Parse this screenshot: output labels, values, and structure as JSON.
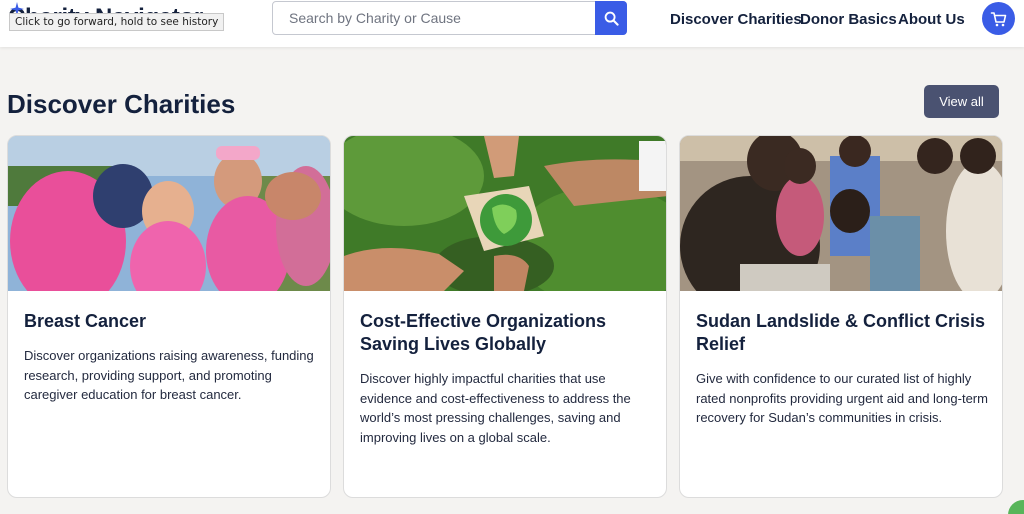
{
  "header": {
    "logo_text": "Charity Navigator",
    "tooltip": "Click to go forward, hold to see history",
    "search_placeholder": "Search by Charity or Cause",
    "nav": [
      "Discover Charities",
      "Donor Basics",
      "About Us"
    ],
    "icons": {
      "search": "search-icon",
      "cart": "cart-icon",
      "logo": "sparkle-icon"
    },
    "accent_color": "#3a5ce6"
  },
  "section": {
    "title": "Discover Charities",
    "view_all_label": "View all"
  },
  "cards": [
    {
      "title": "Breast Cancer",
      "description": "Discover organizations raising awareness, funding research, providing support, and promoting caregiver education for breast cancer.",
      "image": "pink-ribbon-walkers-photo"
    },
    {
      "title": "Cost-Effective Organizations Saving Lives Globally",
      "description": "Discover highly impactful charities that use evidence and cost-effectiveness to address the world’s most pressing challenges, saving and improving lives on a global scale.",
      "image": "hands-puzzle-globe-photo"
    },
    {
      "title": "Sudan Landslide & Conflict Crisis Relief",
      "description": "Give with confidence to our curated list of highly rated nonprofits providing urgent aid and long-term recovery for Sudan’s communities in crisis.",
      "image": "sudan-children-photo"
    }
  ]
}
